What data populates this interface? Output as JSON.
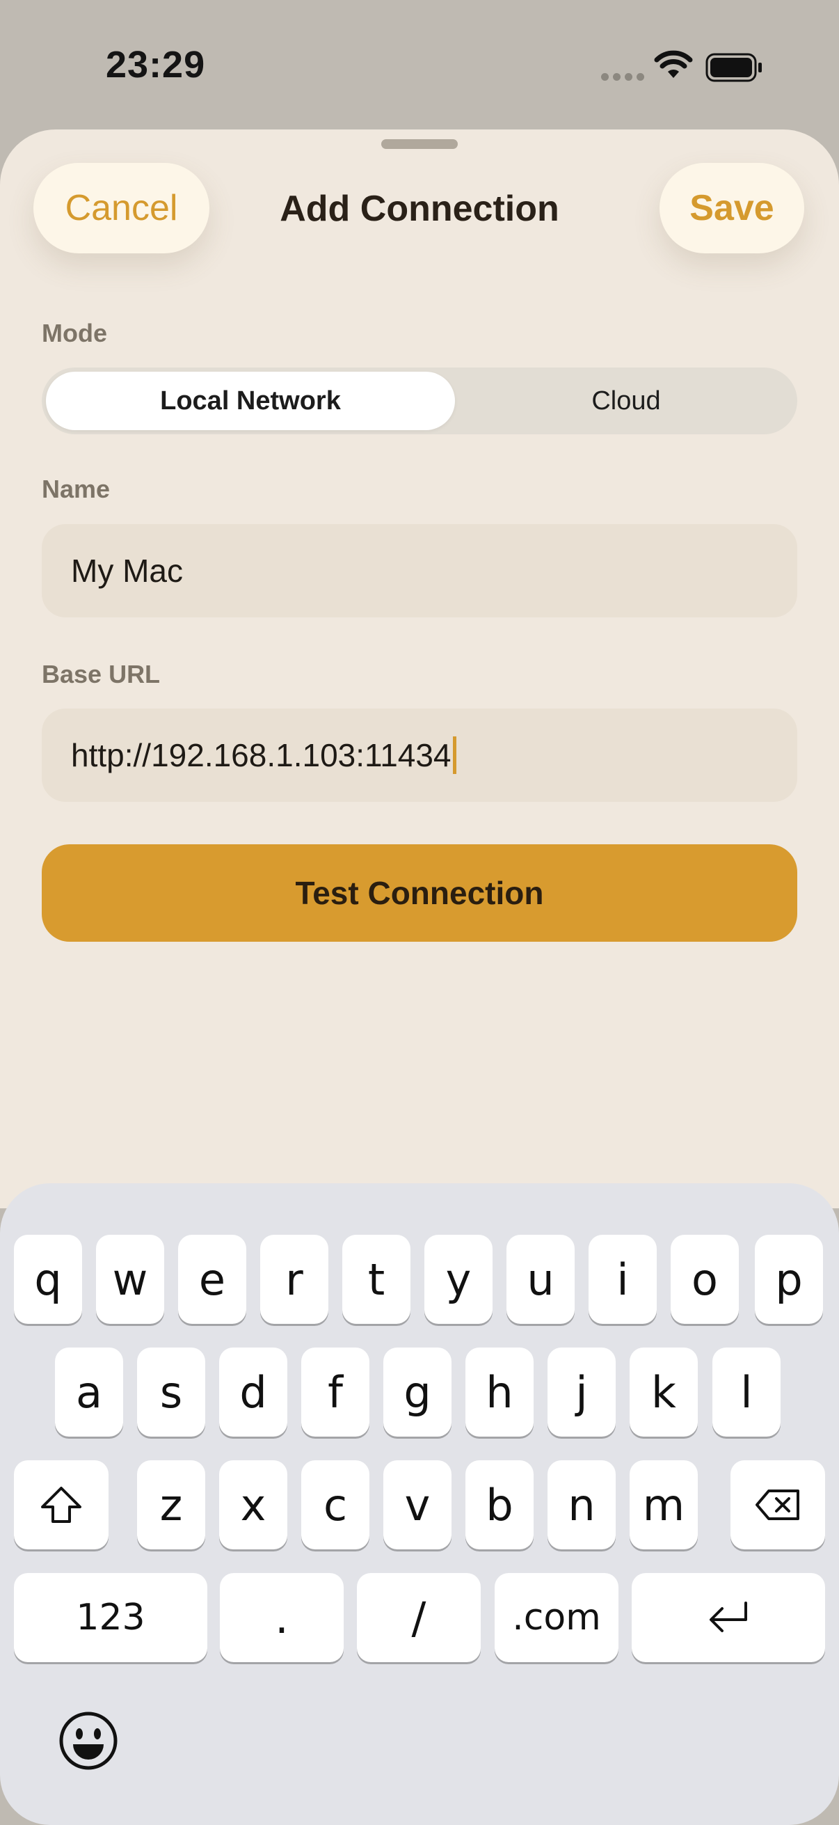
{
  "status_bar": {
    "time": "23:29",
    "icons": [
      "cellular-dots-icon",
      "wifi-icon",
      "battery-icon"
    ]
  },
  "sheet": {
    "title": "Add Connection",
    "cancel_label": "Cancel",
    "save_label": "Save",
    "accent_color": "#D89B2F"
  },
  "form": {
    "mode_label": "Mode",
    "mode_options": [
      "Local Network",
      "Cloud"
    ],
    "mode_selected": "Local Network",
    "name_label": "Name",
    "name_value": "My Mac",
    "url_label": "Base URL",
    "url_value": "http://192.168.1.103:11434",
    "test_button": "Test Connection"
  },
  "keyboard": {
    "row1": [
      "q",
      "w",
      "e",
      "r",
      "t",
      "y",
      "u",
      "i",
      "o",
      "p"
    ],
    "row2": [
      "a",
      "s",
      "d",
      "f",
      "g",
      "h",
      "j",
      "k",
      "l"
    ],
    "row3": [
      "z",
      "x",
      "c",
      "v",
      "b",
      "n",
      "m"
    ],
    "numbers_key": "123",
    "dot_key": ".",
    "slash_key": "/",
    "dotcom_key": ".com",
    "special_icons": [
      "shift-icon",
      "delete-icon",
      "return-icon",
      "emoji-icon"
    ]
  }
}
